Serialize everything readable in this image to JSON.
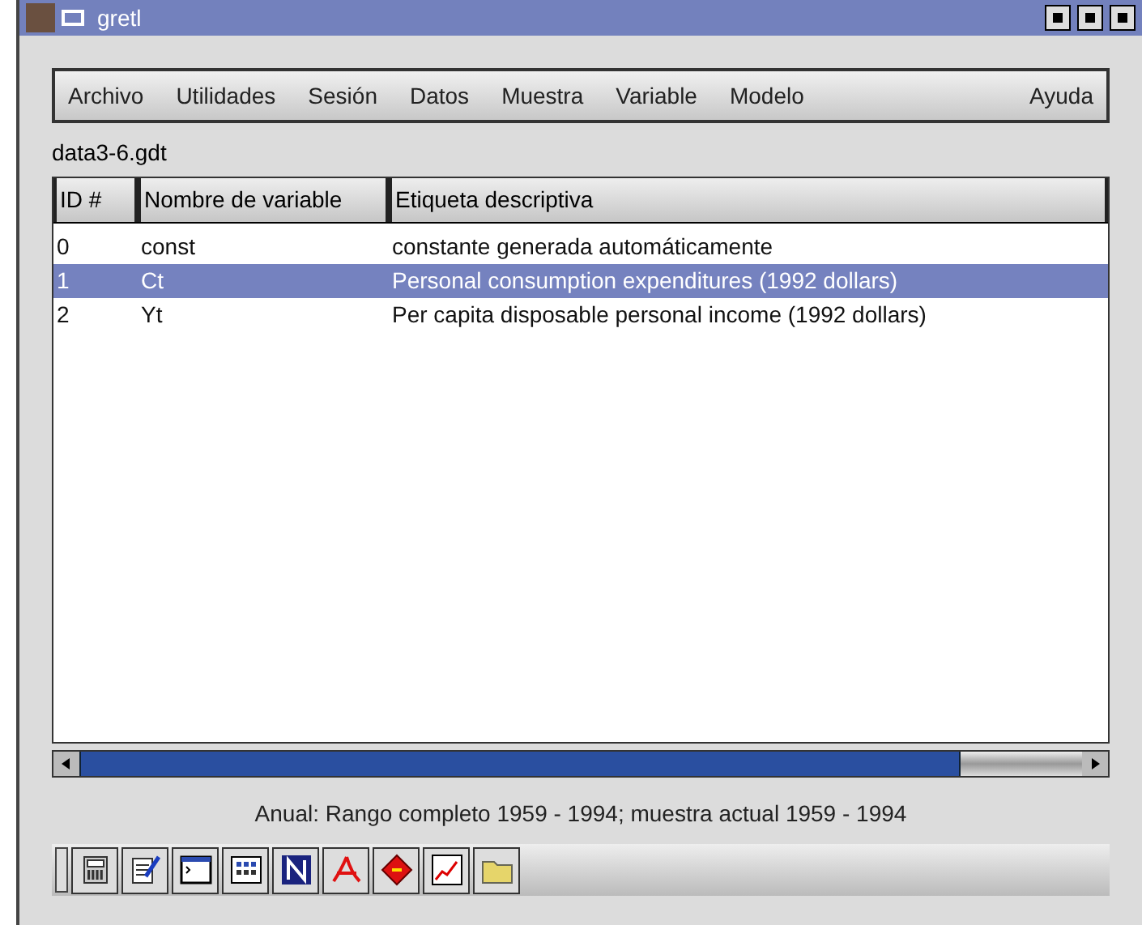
{
  "window": {
    "title": "gretl"
  },
  "menu": [
    "Archivo",
    "Utilidades",
    "Sesión",
    "Datos",
    "Muestra",
    "Variable",
    "Modelo",
    "Ayuda"
  ],
  "filename": "data3-6.gdt",
  "table": {
    "columns": [
      "ID #",
      "Nombre de variable",
      "Etiqueta descriptiva"
    ],
    "rows": [
      {
        "id": "0",
        "name": "const",
        "label": "constante generada automáticamente",
        "selected": false
      },
      {
        "id": "1",
        "name": "Ct",
        "label": "Personal consumption expenditures (1992 dollars)",
        "selected": true
      },
      {
        "id": "2",
        "name": "Yt",
        "label": "Per capita disposable personal income (1992 dollars)",
        "selected": false
      }
    ]
  },
  "status_bar": "Anual: Rango completo 1959 - 1994; muestra actual 1959 - 1994"
}
